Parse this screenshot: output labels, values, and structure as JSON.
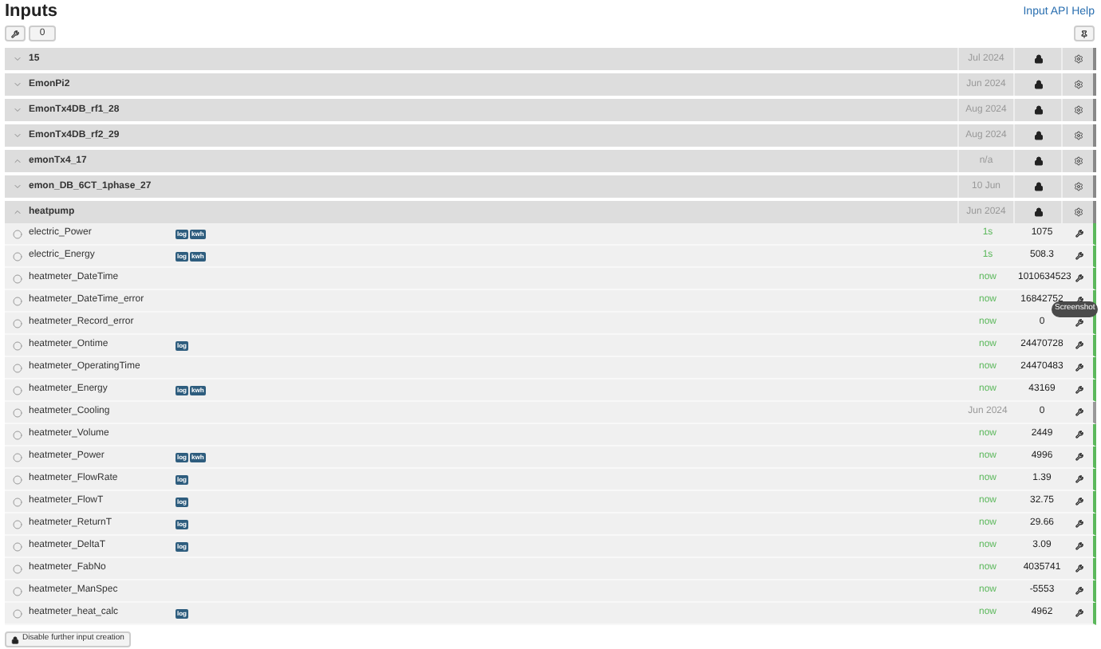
{
  "page": {
    "title": "Inputs",
    "help_link": "Input API Help"
  },
  "toolbar": {
    "selected_count": "0"
  },
  "groups": [
    {
      "name": "15",
      "expanded": false,
      "time": "Jul 2024"
    },
    {
      "name": "EmonPi2",
      "expanded": false,
      "time": "Jun 2024"
    },
    {
      "name": "EmonTx4DB_rf1_28",
      "expanded": false,
      "time": "Aug 2024"
    },
    {
      "name": "EmonTx4DB_rf2_29",
      "expanded": false,
      "time": "Aug 2024"
    },
    {
      "name": "emonTx4_17",
      "expanded": true,
      "time": "n/a"
    },
    {
      "name": "emon_DB_6CT_1phase_27",
      "expanded": false,
      "time": "10 Jun"
    },
    {
      "name": "heatpump",
      "expanded": true,
      "time": "Jun 2024",
      "inputs": [
        {
          "name": "electric_Power",
          "tags": [
            "log",
            "kwh"
          ],
          "time": "1s",
          "active": true,
          "value": "1075"
        },
        {
          "name": "electric_Energy",
          "tags": [
            "log",
            "kwh"
          ],
          "time": "1s",
          "active": true,
          "value": "508.3"
        },
        {
          "name": "heatmeter_DateTime",
          "time": "now",
          "active": true,
          "value": "1010634523"
        },
        {
          "name": "heatmeter_DateTime_error",
          "time": "now",
          "active": true,
          "value": "16842752"
        },
        {
          "name": "heatmeter_Record_error",
          "time": "now",
          "active": true,
          "value": "0"
        },
        {
          "name": "heatmeter_Ontime",
          "tags": [
            "log"
          ],
          "time": "now",
          "active": true,
          "value": "24470728"
        },
        {
          "name": "heatmeter_OperatingTime",
          "time": "now",
          "active": true,
          "value": "24470483"
        },
        {
          "name": "heatmeter_Energy",
          "tags": [
            "log",
            "kwh"
          ],
          "time": "now",
          "active": true,
          "value": "43169"
        },
        {
          "name": "heatmeter_Cooling",
          "time": "Jun 2024",
          "active": false,
          "value": "0"
        },
        {
          "name": "heatmeter_Volume",
          "time": "now",
          "active": true,
          "value": "2449"
        },
        {
          "name": "heatmeter_Power",
          "tags": [
            "log",
            "kwh"
          ],
          "time": "now",
          "active": true,
          "value": "4996"
        },
        {
          "name": "heatmeter_FlowRate",
          "tags": [
            "log"
          ],
          "time": "now",
          "active": true,
          "value": "1.39"
        },
        {
          "name": "heatmeter_FlowT",
          "tags": [
            "log"
          ],
          "time": "now",
          "active": true,
          "value": "32.75"
        },
        {
          "name": "heatmeter_ReturnT",
          "tags": [
            "log"
          ],
          "time": "now",
          "active": true,
          "value": "29.66"
        },
        {
          "name": "heatmeter_DeltaT",
          "tags": [
            "log"
          ],
          "time": "now",
          "active": true,
          "value": "3.09"
        },
        {
          "name": "heatmeter_FabNo",
          "time": "now",
          "active": true,
          "value": "4035741"
        },
        {
          "name": "heatmeter_ManSpec",
          "time": "now",
          "active": true,
          "value": "-5553"
        },
        {
          "name": "heatmeter_heat_calc",
          "tags": [
            "log"
          ],
          "time": "now",
          "active": true,
          "value": "4962"
        }
      ]
    }
  ],
  "tooltip": "Screenshot",
  "footer_button": "Disable further input creation"
}
